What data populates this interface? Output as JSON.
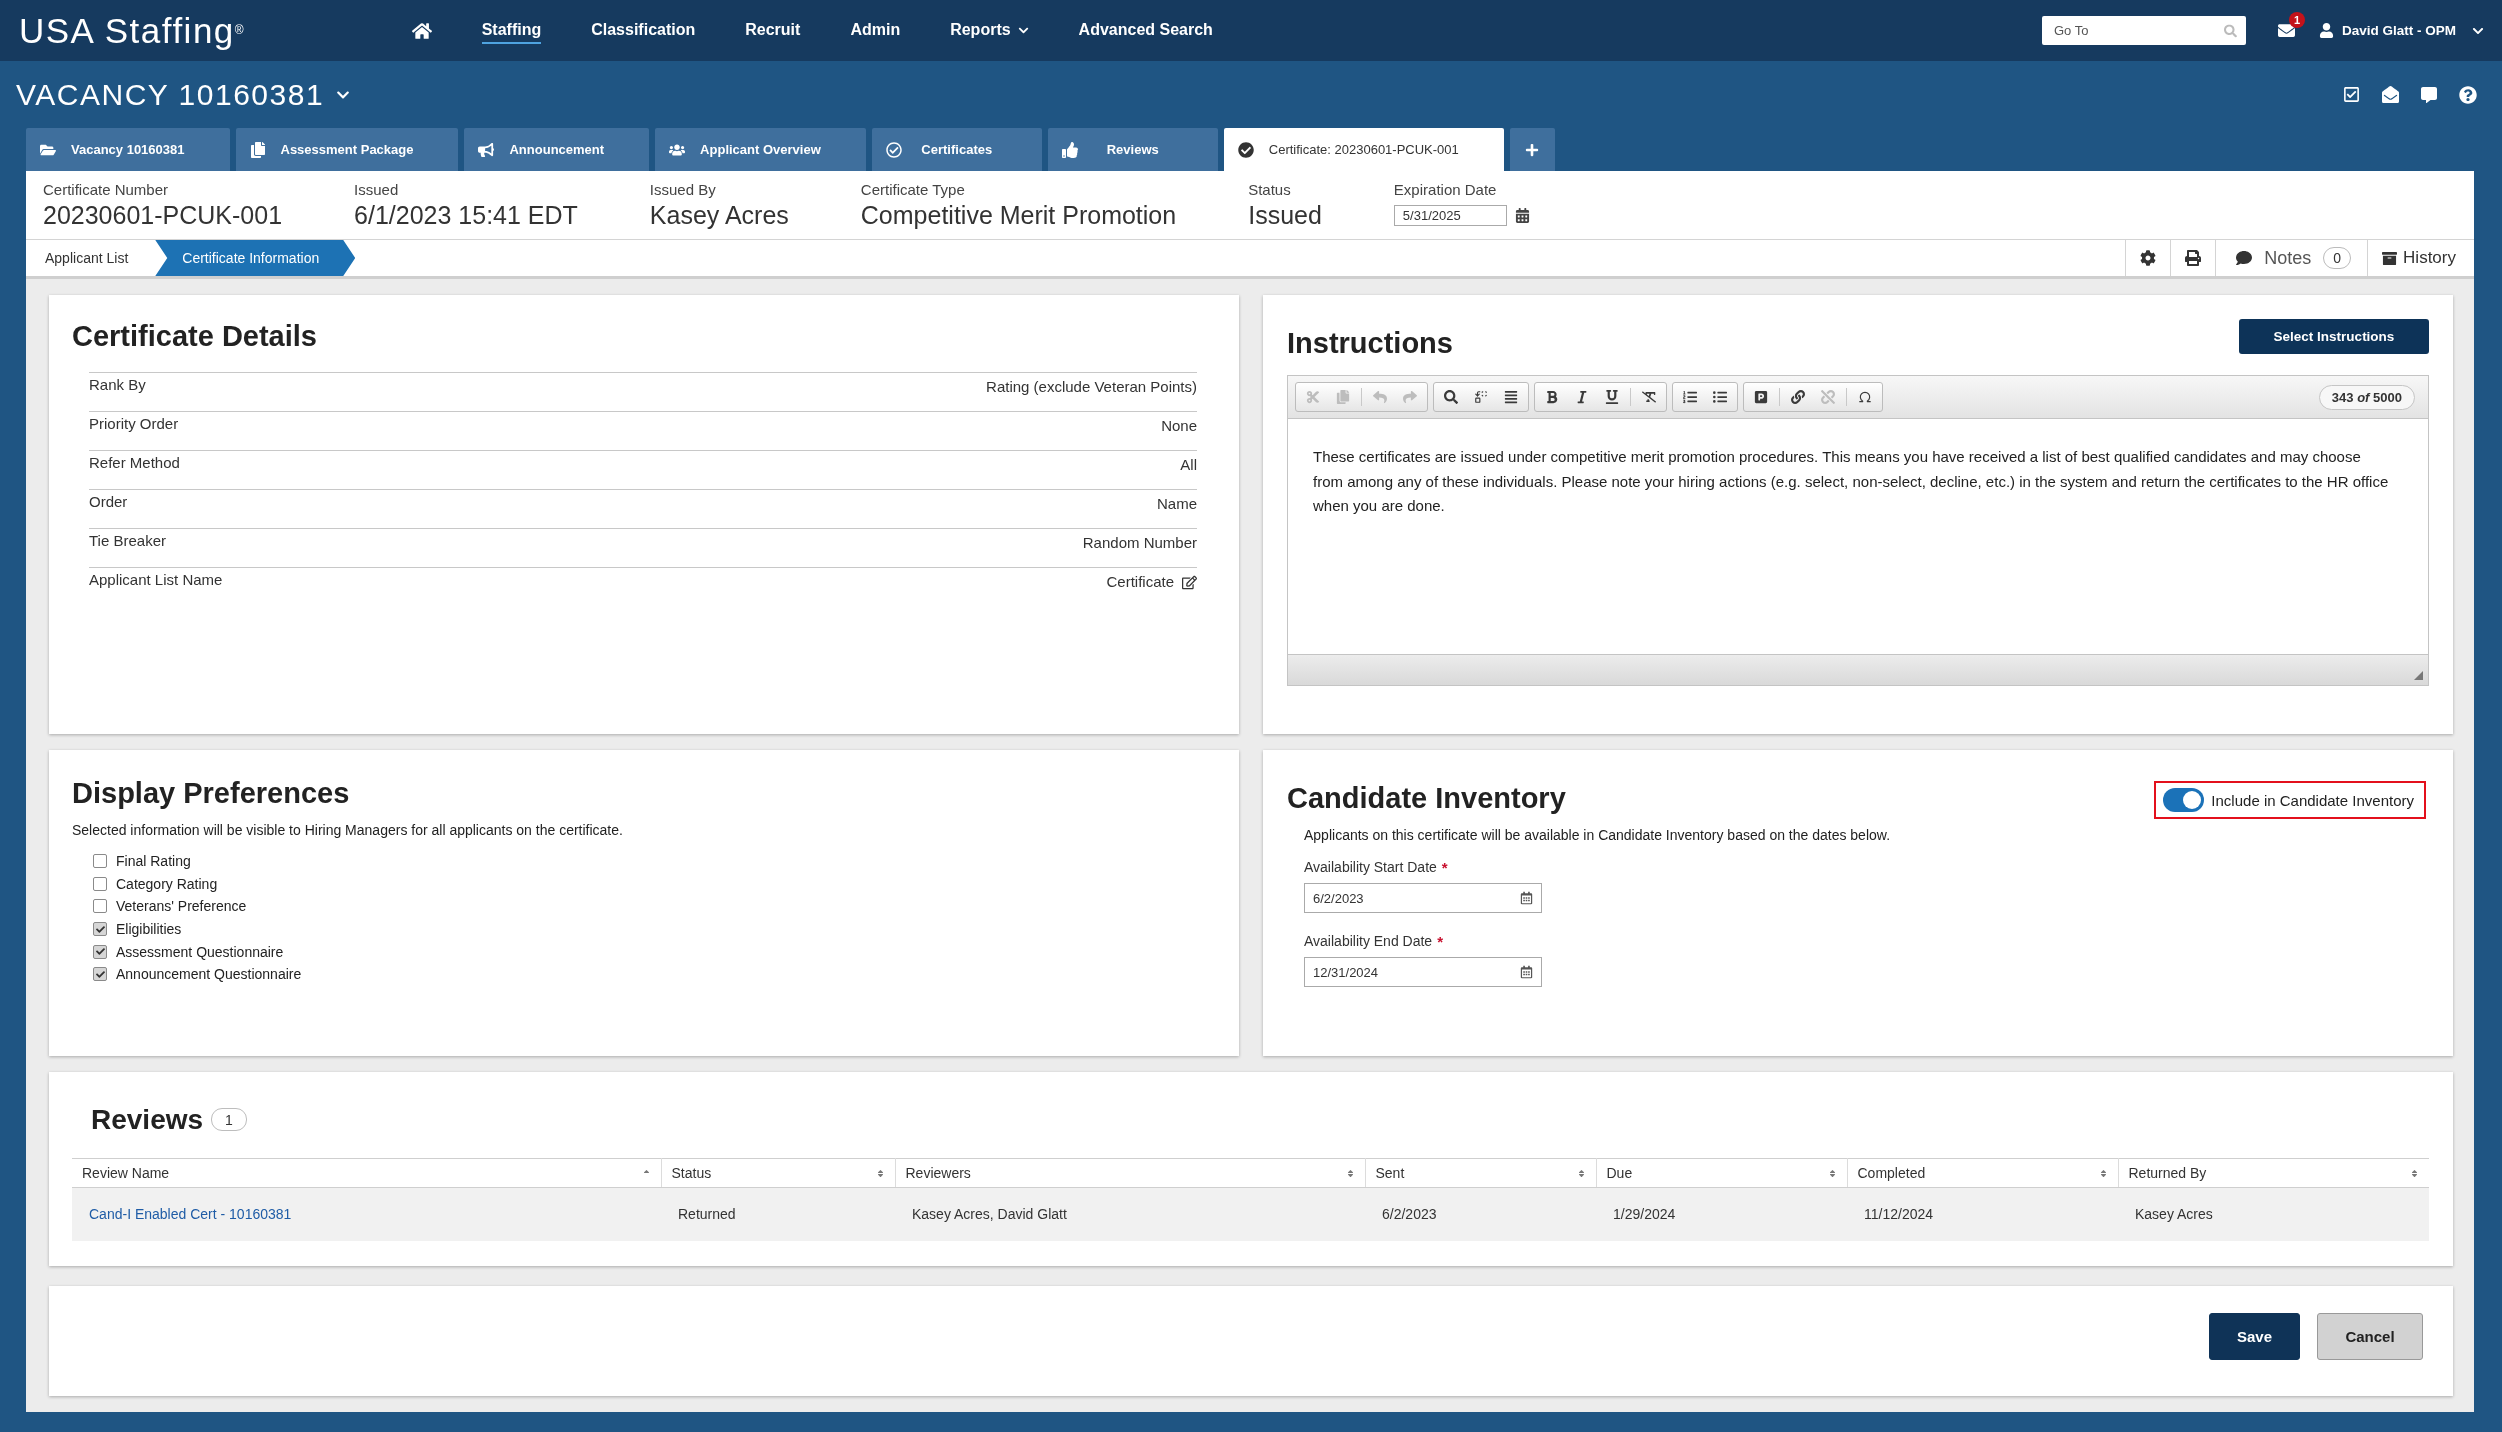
{
  "top_nav": {
    "logo": "USA Staffing$^{®}$",
    "items": [
      {
        "label": "Staffing",
        "selected": true,
        "dropdown": false
      },
      {
        "label": "Classification",
        "selected": false,
        "dropdown": false
      },
      {
        "label": "Recruit",
        "selected": false,
        "dropdown": false
      },
      {
        "label": "Admin",
        "selected": false,
        "dropdown": false
      },
      {
        "label": "Reports",
        "selected": false,
        "dropdown": true
      },
      {
        "label": "Advanced Search",
        "selected": false,
        "dropdown": false
      }
    ],
    "search": {
      "placeholder": "Go To"
    },
    "mail_badge": "1",
    "user": "David Glatt - OPM"
  },
  "vacancy": {
    "title": "VACANCY 10160381"
  },
  "tabs": [
    {
      "label": "Vacancy 10160381",
      "selected": false
    },
    {
      "label": "Assessment Package",
      "selected": false
    },
    {
      "label": "Announcement",
      "selected": false
    },
    {
      "label": "Applicant Overview",
      "selected": false
    },
    {
      "label": "Certificates",
      "selected": false
    },
    {
      "label": "Reviews",
      "selected": false
    },
    {
      "label": "Certificate: 20230601-PCUK-001",
      "selected": true
    }
  ],
  "certificate_header": {
    "fields": [
      {
        "label": "Certificate Number",
        "value": "20230601-PCUK-001"
      },
      {
        "label": "Issued",
        "value": "6/1/2023 15:41 EDT"
      },
      {
        "label": "Issued By",
        "value": "Kasey Acres"
      },
      {
        "label": "Certificate Type",
        "value": "Competitive Merit Promotion"
      },
      {
        "label": "Status",
        "value": "Issued"
      }
    ],
    "expiration": {
      "label": "Expiration Date",
      "value": "5/31/2025"
    }
  },
  "breadcrumb": [
    {
      "label": "Applicant List",
      "selected": false
    },
    {
      "label": "Certificate Information",
      "selected": true
    }
  ],
  "page_tools": {
    "notes": {
      "label": "Notes",
      "count": "0"
    },
    "history": {
      "label": "History"
    }
  },
  "certificate_details": {
    "title": "Certificate Details",
    "rows": [
      {
        "label": "Rank By",
        "value": "Rating (exclude Veteran Points)",
        "editable": false
      },
      {
        "label": "Priority Order",
        "value": "None",
        "editable": false
      },
      {
        "label": "Refer Method",
        "value": "All",
        "editable": false
      },
      {
        "label": "Order",
        "value": "Name",
        "editable": false
      },
      {
        "label": "Tie Breaker",
        "value": "Random Number",
        "editable": false
      },
      {
        "label": "Applicant List Name",
        "value": "Certificate",
        "editable": true
      }
    ]
  },
  "instructions": {
    "title": "Instructions",
    "button": "Select Instructions",
    "toolbar": [
      [
        [
          {
            "disabled": true
          },
          {
            "disabled": true
          }
        ],
        [
          {
            "disabled": true
          },
          {
            "disabled": true
          }
        ]
      ],
      [
        [
          {
            "disabled": false
          },
          {
            "disabled": false
          },
          {
            "disabled": false
          }
        ]
      ],
      [
        [
          {
            "disabled": false
          },
          {
            "disabled": false
          },
          {
            "disabled": false
          }
        ],
        [
          {
            "disabled": false
          }
        ]
      ],
      [
        [
          {
            "disabled": false
          },
          {
            "disabled": false
          }
        ]
      ],
      [
        [
          {
            "disabled": false
          }
        ],
        [
          {
            "disabled": false
          },
          {
            "disabled": true
          }
        ],
        [
          {
            "disabled": false
          }
        ]
      ]
    ],
    "char_count": "343 *of* 5000",
    "text": "These certificates are issued under competitive merit promotion procedures. This means you have received a list of best qualified candidates and may choose from among any of these individuals. Please note your hiring actions (e.g. select, non-select, decline, etc.) in the system and return the certificates to the HR office when you are done."
  },
  "display_preferences": {
    "title": "Display Preferences",
    "description": "Selected information will be visible to Hiring Managers for all applicants on the certificate.",
    "options": [
      {
        "label": "Final Rating",
        "checked": false
      },
      {
        "label": "Category Rating",
        "checked": false
      },
      {
        "label": "Veterans' Preference",
        "checked": false
      },
      {
        "label": "Eligibilities",
        "checked": true
      },
      {
        "label": "Assessment Questionnaire",
        "checked": true
      },
      {
        "label": "Announcement Questionnaire",
        "checked": true
      }
    ]
  },
  "candidate_inventory": {
    "title": "Candidate Inventory",
    "toggle": {
      "label": "Include in Candidate Inventory",
      "on": true,
      "highlighted": true
    },
    "description": "Applicants on this certificate will be available in Candidate Inventory based on the dates below.",
    "fields": [
      {
        "label": "Availability Start Date",
        "required_mark": "*",
        "value": "6/2/2023"
      },
      {
        "label": "Availability End Date",
        "required_mark": "*",
        "value": "12/31/2024"
      }
    ]
  },
  "reviews": {
    "title": "Reviews",
    "count": "1",
    "columns": [
      {
        "label": "Review Name",
        "sorted": true,
        "link": true
      },
      {
        "label": "Status",
        "sorted": false,
        "link": false
      },
      {
        "label": "Reviewers",
        "sorted": false,
        "link": false
      },
      {
        "label": "Sent",
        "sorted": false,
        "link": false
      },
      {
        "label": "Due",
        "sorted": false,
        "link": false
      },
      {
        "label": "Completed",
        "sorted": false,
        "link": false
      },
      {
        "label": "Returned By",
        "sorted": false,
        "link": false
      }
    ],
    "rows": [
      {
        "cells": [
          "Cand-I Enabled Cert - 10160381",
          "Returned",
          "Kasey Acres, David Glatt",
          "6/2/2023",
          "1/29/2024",
          "11/12/2024",
          "Kasey Acres"
        ]
      }
    ]
  },
  "footer": {
    "buttons": [
      {
        "label": "Save",
        "kind": "primary"
      },
      {
        "label": "Cancel",
        "kind": "secondary"
      }
    ]
  }
}
